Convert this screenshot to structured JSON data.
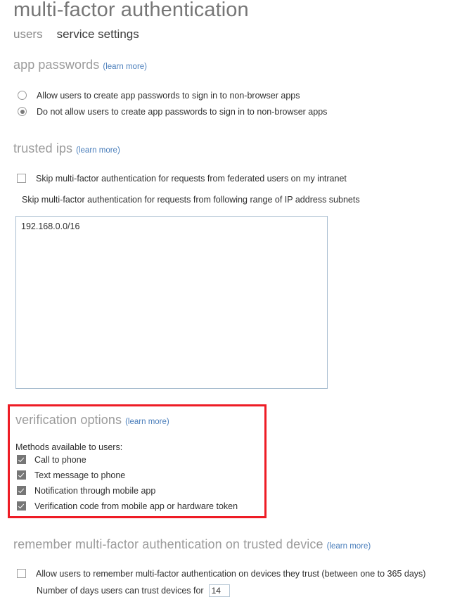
{
  "header": {
    "title": "multi-factor authentication",
    "tabs": [
      {
        "label": "users",
        "active": false
      },
      {
        "label": "service settings",
        "active": true
      }
    ]
  },
  "learn_more_label": "(learn more)",
  "sections": {
    "app_passwords": {
      "title": "app passwords",
      "learn_more": "(learn more)",
      "options": [
        {
          "label": "Allow users to create app passwords to sign in to non-browser apps",
          "selected": false
        },
        {
          "label": "Do not allow users to create app passwords to sign in to non-browser apps",
          "selected": true
        }
      ]
    },
    "trusted_ips": {
      "title": "trusted ips",
      "learn_more": "(learn more)",
      "skip_federated": {
        "label": "Skip multi-factor authentication for requests from federated users on my intranet",
        "checked": false
      },
      "subnet_label": "Skip multi-factor authentication for requests from following range of IP address subnets",
      "subnet_value": "192.168.0.0/16"
    },
    "verification_options": {
      "title": "verification options",
      "learn_more": "(learn more)",
      "methods_label": "Methods available to users:",
      "methods": [
        {
          "label": "Call to phone",
          "checked": true
        },
        {
          "label": "Text message to phone",
          "checked": true
        },
        {
          "label": "Notification through mobile app",
          "checked": true
        },
        {
          "label": "Verification code from mobile app or hardware token",
          "checked": true
        }
      ],
      "highlight_color": "#ee1c25"
    },
    "remember_mfa": {
      "title": "remember multi-factor authentication on trusted device",
      "learn_more": "(learn more)",
      "allow_remember": {
        "label": "Allow users to remember multi-factor authentication on devices they trust (between one to 365 days)",
        "checked": false
      },
      "days_label": "Number of days users can trust devices for",
      "days_value": "14"
    }
  },
  "colors": {
    "heading": "#9b9b9b",
    "link": "#4a7ebb",
    "text": "#2f2f2f",
    "checkbox_fill": "#767676",
    "highlight": "#ee1c25",
    "input_border": "#a8bdd0"
  }
}
